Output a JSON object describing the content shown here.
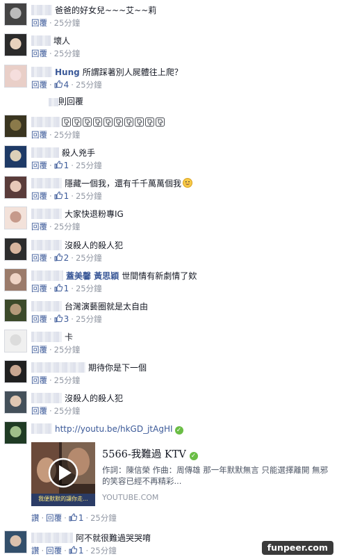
{
  "colors": {
    "link": "#3b5998",
    "text": "#141823",
    "meta": "#9197a3",
    "verify": "#6abd45"
  },
  "labels": {
    "reply": "回覆",
    "liked": "讚"
  },
  "comments": [
    {
      "prefix": "",
      "name": "",
      "text": "爸爸的好女兒~~~艾~~莉",
      "time": "25分鐘",
      "likes": ""
    },
    {
      "prefix": "",
      "name": "",
      "text": "壞人",
      "time": "25分鐘",
      "likes": ""
    },
    {
      "prefix": "",
      "name": "Hung",
      "text": "所謂踩著別人屍體往上爬？",
      "time": "25分鐘",
      "likes": "4",
      "reply_line": "則回覆"
    },
    {
      "prefix": "",
      "name": "",
      "text": "",
      "time": "25分鐘",
      "likes": "",
      "dislike_count": 10
    },
    {
      "prefix": "",
      "name": "",
      "text": "殺人兇手",
      "time": "25分鐘",
      "likes": "1"
    },
    {
      "prefix": "",
      "name": "",
      "text": "隱藏一個我，還有千千萬萬個我",
      "time": "25分鐘",
      "likes": "1"
    },
    {
      "prefix": "",
      "name": "",
      "text": "大家快退粉專IG",
      "time": "25分鐘",
      "likes": ""
    },
    {
      "prefix": "",
      "name": "",
      "text": "沒殺人的殺人犯",
      "time": "25分鐘",
      "likes": "2"
    },
    {
      "prefix": "",
      "name": "蓋美馨 黃思穎",
      "text": "世間情有新劇情了欸",
      "time": "25分鐘",
      "likes": "1"
    },
    {
      "prefix": "",
      "name": "",
      "text": "台灣演藝圈就是太自由",
      "time": "25分鐘",
      "likes": "3"
    },
    {
      "prefix": "",
      "name": "",
      "text": "卡",
      "time": "25分鐘",
      "likes": ""
    },
    {
      "prefix": "",
      "name": "",
      "text": "期待你是下一個",
      "time": "25分鐘",
      "likes": ""
    },
    {
      "prefix": "",
      "name": "",
      "text": "沒殺人的殺人犯",
      "time": "25分鐘",
      "likes": ""
    },
    {
      "prefix": "",
      "name": "",
      "text": "http://youtu.be/hkGD_jtAgHI",
      "time": "25分鐘",
      "likes": "1",
      "meta_prefix": "讚"
    },
    {
      "prefix": "",
      "name": "",
      "text": "阿不就很難過哭哭唷",
      "time": "25分鐘",
      "likes": "1",
      "meta_prefix": "讚"
    }
  ],
  "link_card": {
    "title": "5566-我難過 KTV",
    "description": "作詞：陳信榮 作曲：周傳雄 那一年默默無言 只能選擇離開 無邪的笑容已經不再精彩...",
    "site": "YOUTUBE.COM",
    "thumb_caption": "我便默默的讓你走..."
  },
  "watermark": "funpeer.com"
}
